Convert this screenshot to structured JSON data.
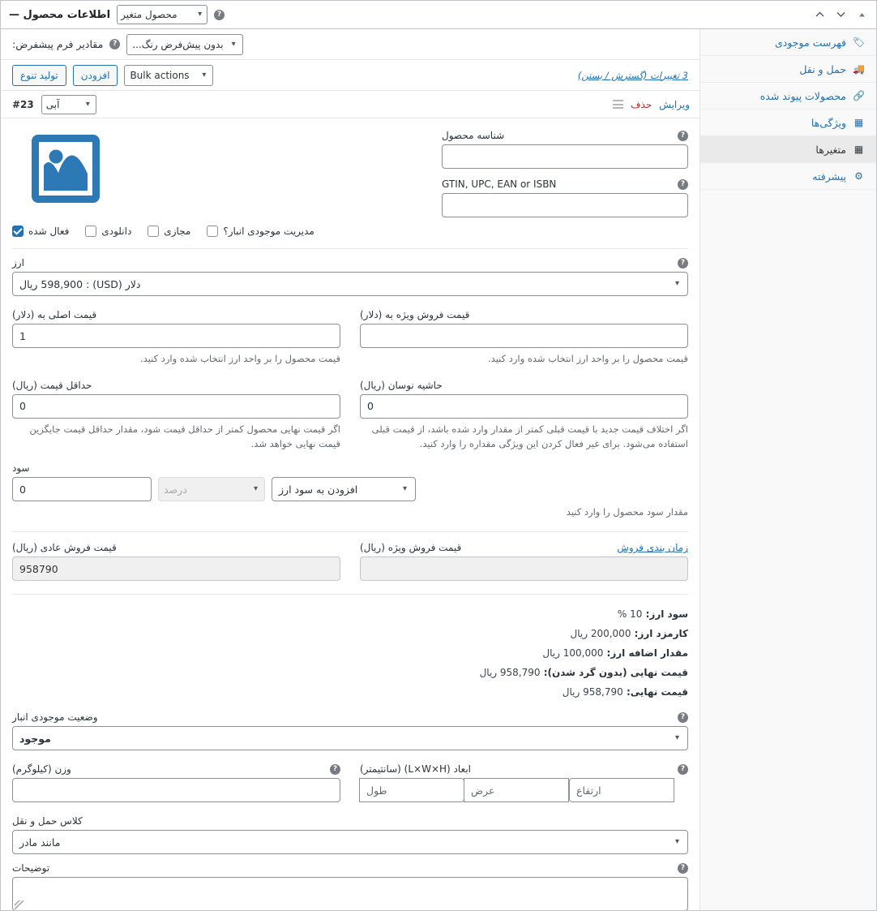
{
  "header": {
    "title": "اطلاعات محصول — ",
    "product_type": "محصول متغیر",
    "help_icon": "help-circle-icon",
    "order_up_icon": "caret-up-filled-icon",
    "move_down_icon": "chevron-down-icon",
    "move_up_icon": "chevron-up-icon"
  },
  "sidebar": {
    "items": [
      {
        "label": "فهرست موجودی",
        "icon": "tag-icon",
        "active": false
      },
      {
        "label": "حمل و نقل",
        "icon": "truck-icon",
        "active": false
      },
      {
        "label": "محصولات پیوند شده",
        "icon": "link-icon",
        "active": false
      },
      {
        "label": "ویژگی‌ها",
        "icon": "attributes-icon",
        "active": false
      },
      {
        "label": "متغیرها",
        "icon": "grid-icon",
        "active": true
      },
      {
        "label": "پیشرفته",
        "icon": "gear-icon",
        "active": false
      }
    ]
  },
  "defaults_row": {
    "label": "مقادیر فرم پیشفرض:",
    "help_icon": "help-circle-icon",
    "select_value": "بدون پیش‌فرض رنگ..."
  },
  "actions_row": {
    "generate_button": "تولید تنوع",
    "add_button": "افزودن",
    "bulk_select": "Bulk actions",
    "changes_text": "3 تغییرات (گسترش / بستن)"
  },
  "variation": {
    "id": "#23",
    "attribute_value": "آبی",
    "edit_label": "ویرایش",
    "delete_label": "حذف",
    "drag_icon": "drag-handle-icon",
    "thumbnail_icon": "image-placeholder-icon",
    "sku": {
      "label": "شناسه محصول",
      "value": "",
      "help_icon": "help-circle-icon"
    },
    "gtin": {
      "label": "GTIN, UPC, EAN or ISBN",
      "value": "",
      "help_icon": "help-circle-icon"
    },
    "checkboxes": [
      {
        "label": "فعال شده",
        "checked": true
      },
      {
        "label": "دانلودی",
        "checked": false
      },
      {
        "label": "مجازی",
        "checked": false
      },
      {
        "label": "مدیریت موجودی انبار؟",
        "checked": false
      }
    ],
    "currency": {
      "label": "ارز",
      "help_icon": "help-circle-icon",
      "value": "دلار (USD) : 598,900 ریال"
    },
    "price_base": {
      "label": "قیمت اصلی به (دلار)",
      "value": "1",
      "hint": "قیمت محصول را بر واحد ارز انتخاب شده وارد کنید."
    },
    "price_sale_currency": {
      "label": "قیمت فروش ویژه به (دلار)",
      "value": "",
      "hint": "قیمت محصول را بر واحد ارز انتخاب شده وارد کنید."
    },
    "price_min": {
      "label": "حداقل قیمت (ریال)",
      "value": "0",
      "hint": "اگر قیمت نهایی محصول کمتر از حداقل قیمت شود، مقدار حداقل قیمت جایگزین قیمت نهایی خواهد شد."
    },
    "price_margin": {
      "label": "حاشیه نوسان (ریال)",
      "value": "0",
      "hint": "اگر اختلاف قیمت جدید با قیمت قبلی کمتر از مقدار وارد شده باشد، از قیمت قبلی استفاده می‌شود. برای غیر فعال کردن این ویژگی مقداره را وارد کنید."
    },
    "profit": {
      "label": "سود",
      "amount": "0",
      "percent_placeholder": "درصد",
      "mode": "افزودن به سود ارز",
      "hint": "مقدار سود محصول را وارد کنید"
    },
    "regular_price": {
      "label": "قیمت فروش عادی (ریال)",
      "value": "958790"
    },
    "sale_price": {
      "label": "قیمت فروش ویژه (ریال)",
      "schedule_link": "زمان بندی فروش",
      "value": ""
    },
    "summary": [
      {
        "label": "سود ارز:",
        "value": "10 %"
      },
      {
        "label": "کارمزد ارز:",
        "value": "200,000 ریال"
      },
      {
        "label": "مقدار اضافه ارز:",
        "value": "100,000 ریال"
      },
      {
        "label": "قیمت نهایی (بدون گرد شدن):",
        "value": "958,790 ریال"
      },
      {
        "label": "قیمت نهایی:",
        "value": "958,790 ریال"
      }
    ],
    "stock_status": {
      "label": "وضعیت موجودی انبار",
      "help_icon": "help-circle-icon",
      "value": "موجود"
    },
    "weight": {
      "label": "وزن (کیلوگرم)",
      "help_icon": "help-circle-icon",
      "value": ""
    },
    "dimensions": {
      "label": "ابعاد (L×W×H) (سانتیمتر)",
      "help_icon": "help-circle-icon",
      "length_placeholder": "طول",
      "width_placeholder": "عرض",
      "height_placeholder": "ارتفاع"
    },
    "shipping_class": {
      "label": "کلاس حمل و نقل",
      "value": "مانند مادر"
    },
    "description": {
      "label": "توضیحات",
      "help_icon": "help-circle-icon",
      "value": ""
    }
  },
  "colors": {
    "accent": "#2271b1",
    "danger": "#b32d2e",
    "border": "#c3c4c7",
    "muted": "#646970"
  }
}
